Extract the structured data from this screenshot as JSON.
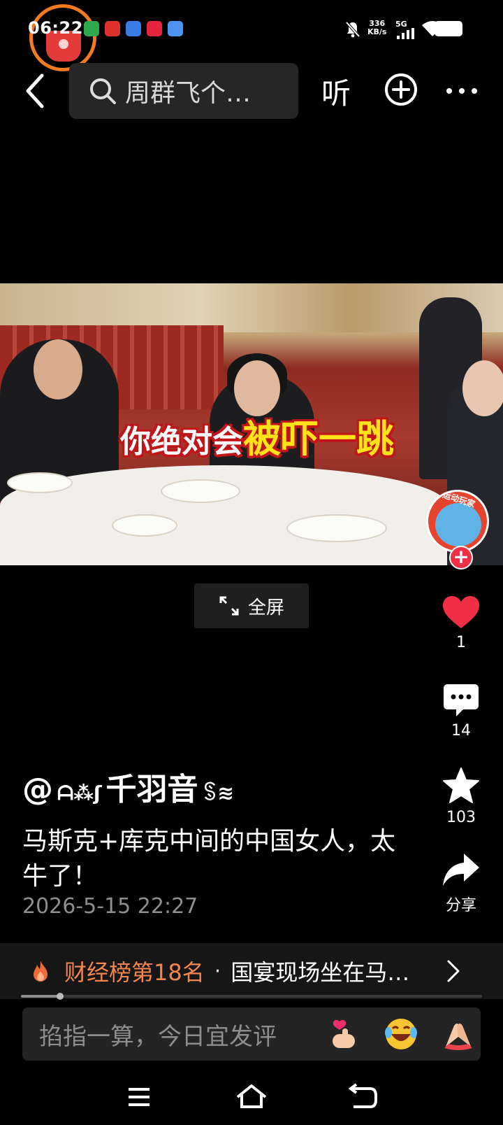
{
  "status_bar": {
    "time": "06:22",
    "net_speed_value": "336",
    "net_speed_unit": "KB/s",
    "network": "5G",
    "icons": [
      "bell-muted-icon",
      "signal-icon",
      "wifi-icon",
      "battery-icon"
    ]
  },
  "top_bar": {
    "search_text": "周群飞个…",
    "listen_label": "听"
  },
  "video": {
    "caption_part1": "你绝对会",
    "caption_part2": "被吓一跳",
    "badge_text": "运动玩家",
    "fullscreen_label": "全屏"
  },
  "actions": {
    "likes": "1",
    "comments": "14",
    "favorites": "103",
    "share_label": "分享"
  },
  "post": {
    "author_prefix": "@",
    "author_name": "千羽音",
    "caption": "马斯克+库克中间的中国女人，太牛了！",
    "date": "2026-5-15 22:27"
  },
  "hot_bar": {
    "rank": "财经榜第18名",
    "separator": "·",
    "title": "国宴现场坐在马…"
  },
  "playback": {
    "progress_fraction": 0.085
  },
  "comment_bar": {
    "placeholder": "掐指一算，今日宜发评",
    "emojis": [
      "finger-heart-emoji",
      "laughing-emoji",
      "clap-emoji"
    ]
  },
  "colors": {
    "accent_red": "#ef2f45",
    "hot_orange": "#f3864e",
    "background": "#000000"
  }
}
